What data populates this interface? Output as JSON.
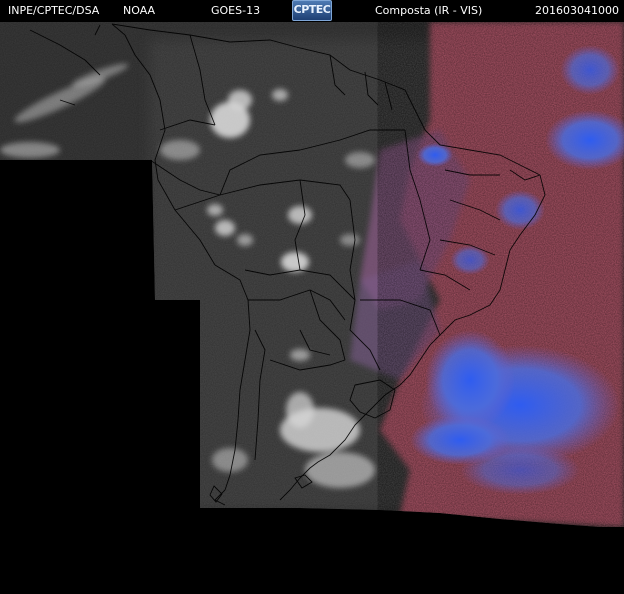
{
  "header": {
    "agency": "INPE/CPTEC/DSA",
    "noaa": "NOAA",
    "satellite": "GOES-13",
    "logo": "CPTEC",
    "product": "Composta (IR - VIS)",
    "timestamp": "201603041000"
  },
  "colors": {
    "background": "#000000",
    "ir_cold_cloud": "#3a63e6",
    "ir_warm_cloud": "#c65a6e",
    "visible_cloud": "#d8d8d8",
    "land": "#4a4a4a",
    "borders": "#000000"
  }
}
